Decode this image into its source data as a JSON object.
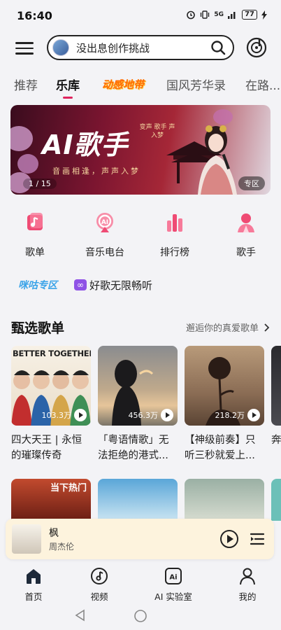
{
  "status": {
    "time": "16:40",
    "network": "5G",
    "battery": "77"
  },
  "search": {
    "placeholder": "没出息创作挑战"
  },
  "tabs": [
    {
      "label": "推荐"
    },
    {
      "label": "乐库"
    },
    {
      "label": "动感地带"
    },
    {
      "label": "国风芳华录"
    },
    {
      "label": "在路..."
    }
  ],
  "banner": {
    "title": "AI歌手",
    "subtitle": "音画相逢，声声入梦",
    "tag": "变声 歌手 声入梦",
    "counter": "1 / 15",
    "zone_label": "专区"
  },
  "entries": [
    {
      "label": "歌单",
      "icon": "songlist-icon"
    },
    {
      "label": "音乐电台",
      "icon": "radio-icon"
    },
    {
      "label": "排行榜",
      "icon": "chart-bars-icon"
    },
    {
      "label": "歌手",
      "icon": "singer-icon"
    }
  ],
  "promo": {
    "migu": "咪咕专区",
    "text": "好歌无限畅听"
  },
  "section": {
    "title": "甄选歌单",
    "more": "邂逅你的真爱歌单"
  },
  "playlists": [
    {
      "cover_text": "BETTER TOGETHER",
      "plays": "103.3万",
      "name": "四大天王 | 永恒的璀璨传奇"
    },
    {
      "cover_text": "",
      "plays": "456.3万",
      "name": "「粤语情歌」无法拒绝的港式..."
    },
    {
      "cover_text": "",
      "plays": "218.2万",
      "name": "【神级前奏】只听三秒就爱上..."
    },
    {
      "cover_text": "",
      "plays": "",
      "name": "奔"
    }
  ],
  "row2": {
    "hot_label": "当下热门"
  },
  "player": {
    "song": "枫",
    "artist": "周杰伦"
  },
  "nav": [
    {
      "label": "首页",
      "icon": "home-icon"
    },
    {
      "label": "视频",
      "icon": "video-icon"
    },
    {
      "label": "AI 实验室",
      "icon": "ai-lab-icon"
    },
    {
      "label": "我的",
      "icon": "profile-icon"
    }
  ],
  "colors": {
    "accent": "#e0245e",
    "player_bg": "#fdf3dd",
    "page_bg": "#f3f3f6"
  }
}
